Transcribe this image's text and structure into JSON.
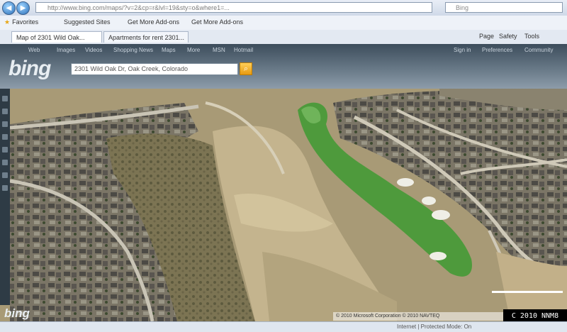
{
  "browser": {
    "url": "http://www.bing.com/maps/?v=2&cp=r&lvl=19&sty=o&where1=...",
    "search_placeholder": "Bing",
    "favorites": [
      {
        "label": "Favorites"
      },
      {
        "label": "Suggested Sites"
      },
      {
        "label": "Get More Add-ons"
      },
      {
        "label": "Get More Add-ons"
      }
    ],
    "tabs": [
      {
        "label": "Map of 2301 Wild Oak..."
      },
      {
        "label": "Apartments for rent 2301..."
      }
    ],
    "commands": [
      "Page",
      "Safety",
      "Tools"
    ]
  },
  "bing": {
    "logo": "bing",
    "nav": [
      "Web",
      "Images",
      "Videos",
      "Shopping",
      "News",
      "Maps",
      "More",
      "MSN",
      "Hotmail"
    ],
    "nav_right": [
      "Sign in",
      "Preferences",
      "Community"
    ],
    "search_value": "2301 Wild Oak Dr, Oak Creek, Colorado"
  },
  "map": {
    "watermark": "bing",
    "footer": "© 2010 Microsoft Corporation   © 2010 NAVTEQ",
    "copyright_box": "C 2010 NNM8"
  },
  "status": {
    "text": "Internet | Protected Mode: On"
  },
  "colors": {
    "fairway": "#4e9a3c",
    "terrain": "#b9a77f"
  }
}
